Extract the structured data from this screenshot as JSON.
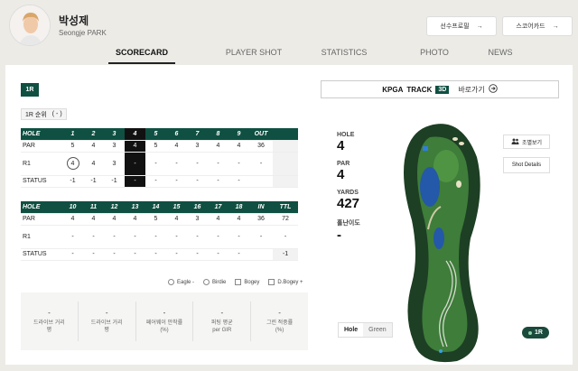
{
  "profile": {
    "name_ko": "박성제",
    "name_en": "Seongje PARK"
  },
  "header_buttons": {
    "profile": "선수프로필",
    "scorecard": "스코어카드",
    "arrow": "→"
  },
  "tabs": [
    "SCORECARD",
    "PLAYER SHOT",
    "STATISTICS",
    "PHOTO",
    "NEWS"
  ],
  "active_tab": "SCORECARD",
  "round_badge": "1R",
  "rank": {
    "label": "1R 순위",
    "value": "( - )"
  },
  "front": {
    "header": [
      "HOLE",
      "1",
      "2",
      "3",
      "4",
      "5",
      "6",
      "7",
      "8",
      "9",
      "OUT",
      ""
    ],
    "par": [
      "PAR",
      "5",
      "4",
      "3",
      "4",
      "5",
      "4",
      "3",
      "4",
      "4",
      "36",
      ""
    ],
    "r1": [
      "R1",
      "4",
      "4",
      "3",
      "-",
      "-",
      "-",
      "-",
      "-",
      "-",
      "-",
      ""
    ],
    "status": [
      "STATUS",
      "-1",
      "-1",
      "-1",
      "-",
      "-",
      "-",
      "-",
      "-",
      "-",
      "",
      ""
    ]
  },
  "back": {
    "header": [
      "HOLE",
      "10",
      "11",
      "12",
      "13",
      "14",
      "15",
      "16",
      "17",
      "18",
      "IN",
      "TTL"
    ],
    "par": [
      "PAR",
      "4",
      "4",
      "4",
      "4",
      "5",
      "4",
      "3",
      "4",
      "4",
      "36",
      "72"
    ],
    "r1": [
      "R1",
      "-",
      "-",
      "-",
      "-",
      "-",
      "-",
      "-",
      "-",
      "-",
      "-",
      "-"
    ],
    "status": [
      "STATUS",
      "-",
      "-",
      "-",
      "-",
      "-",
      "-",
      "-",
      "-",
      "-",
      "",
      "-1"
    ]
  },
  "legend": {
    "eagle": "Eagle -",
    "birdie": "Birdie",
    "bogey": "Bogey",
    "dbogey": "D.Bogey +"
  },
  "stats": [
    {
      "value": "-",
      "label": "드라이브 거리\n평"
    },
    {
      "value": "-",
      "label": "드라이브 거리\n평"
    },
    {
      "value": "-",
      "label": "페어웨이 안착률\n(%)"
    },
    {
      "value": "-",
      "label": "퍼팅 평균\nper GIR"
    },
    {
      "value": "-",
      "label": "그린 적중률\n(%)"
    }
  ],
  "kpga": {
    "brand": "KPGA",
    "track": "TRACK",
    "badge": "3D",
    "link": "바로가기"
  },
  "hole_info": {
    "hole_label": "HOLE",
    "hole_value": "4",
    "par_label": "PAR",
    "par_value": "4",
    "yards_label": "YARDS",
    "yards_value": "427",
    "difficulty_label": "홀난이도",
    "difficulty_value": "-"
  },
  "map_buttons": {
    "group": "조별보기",
    "shot": "Shot Details"
  },
  "toggle": {
    "hole": "Hole",
    "green": "Green"
  },
  "round_pill": "1R",
  "colors": {
    "accent": "#0f5042",
    "current_hole": "#111111",
    "fairway": "#3f7d3a",
    "rough": "#1d3f24",
    "water": "#2458a8"
  }
}
